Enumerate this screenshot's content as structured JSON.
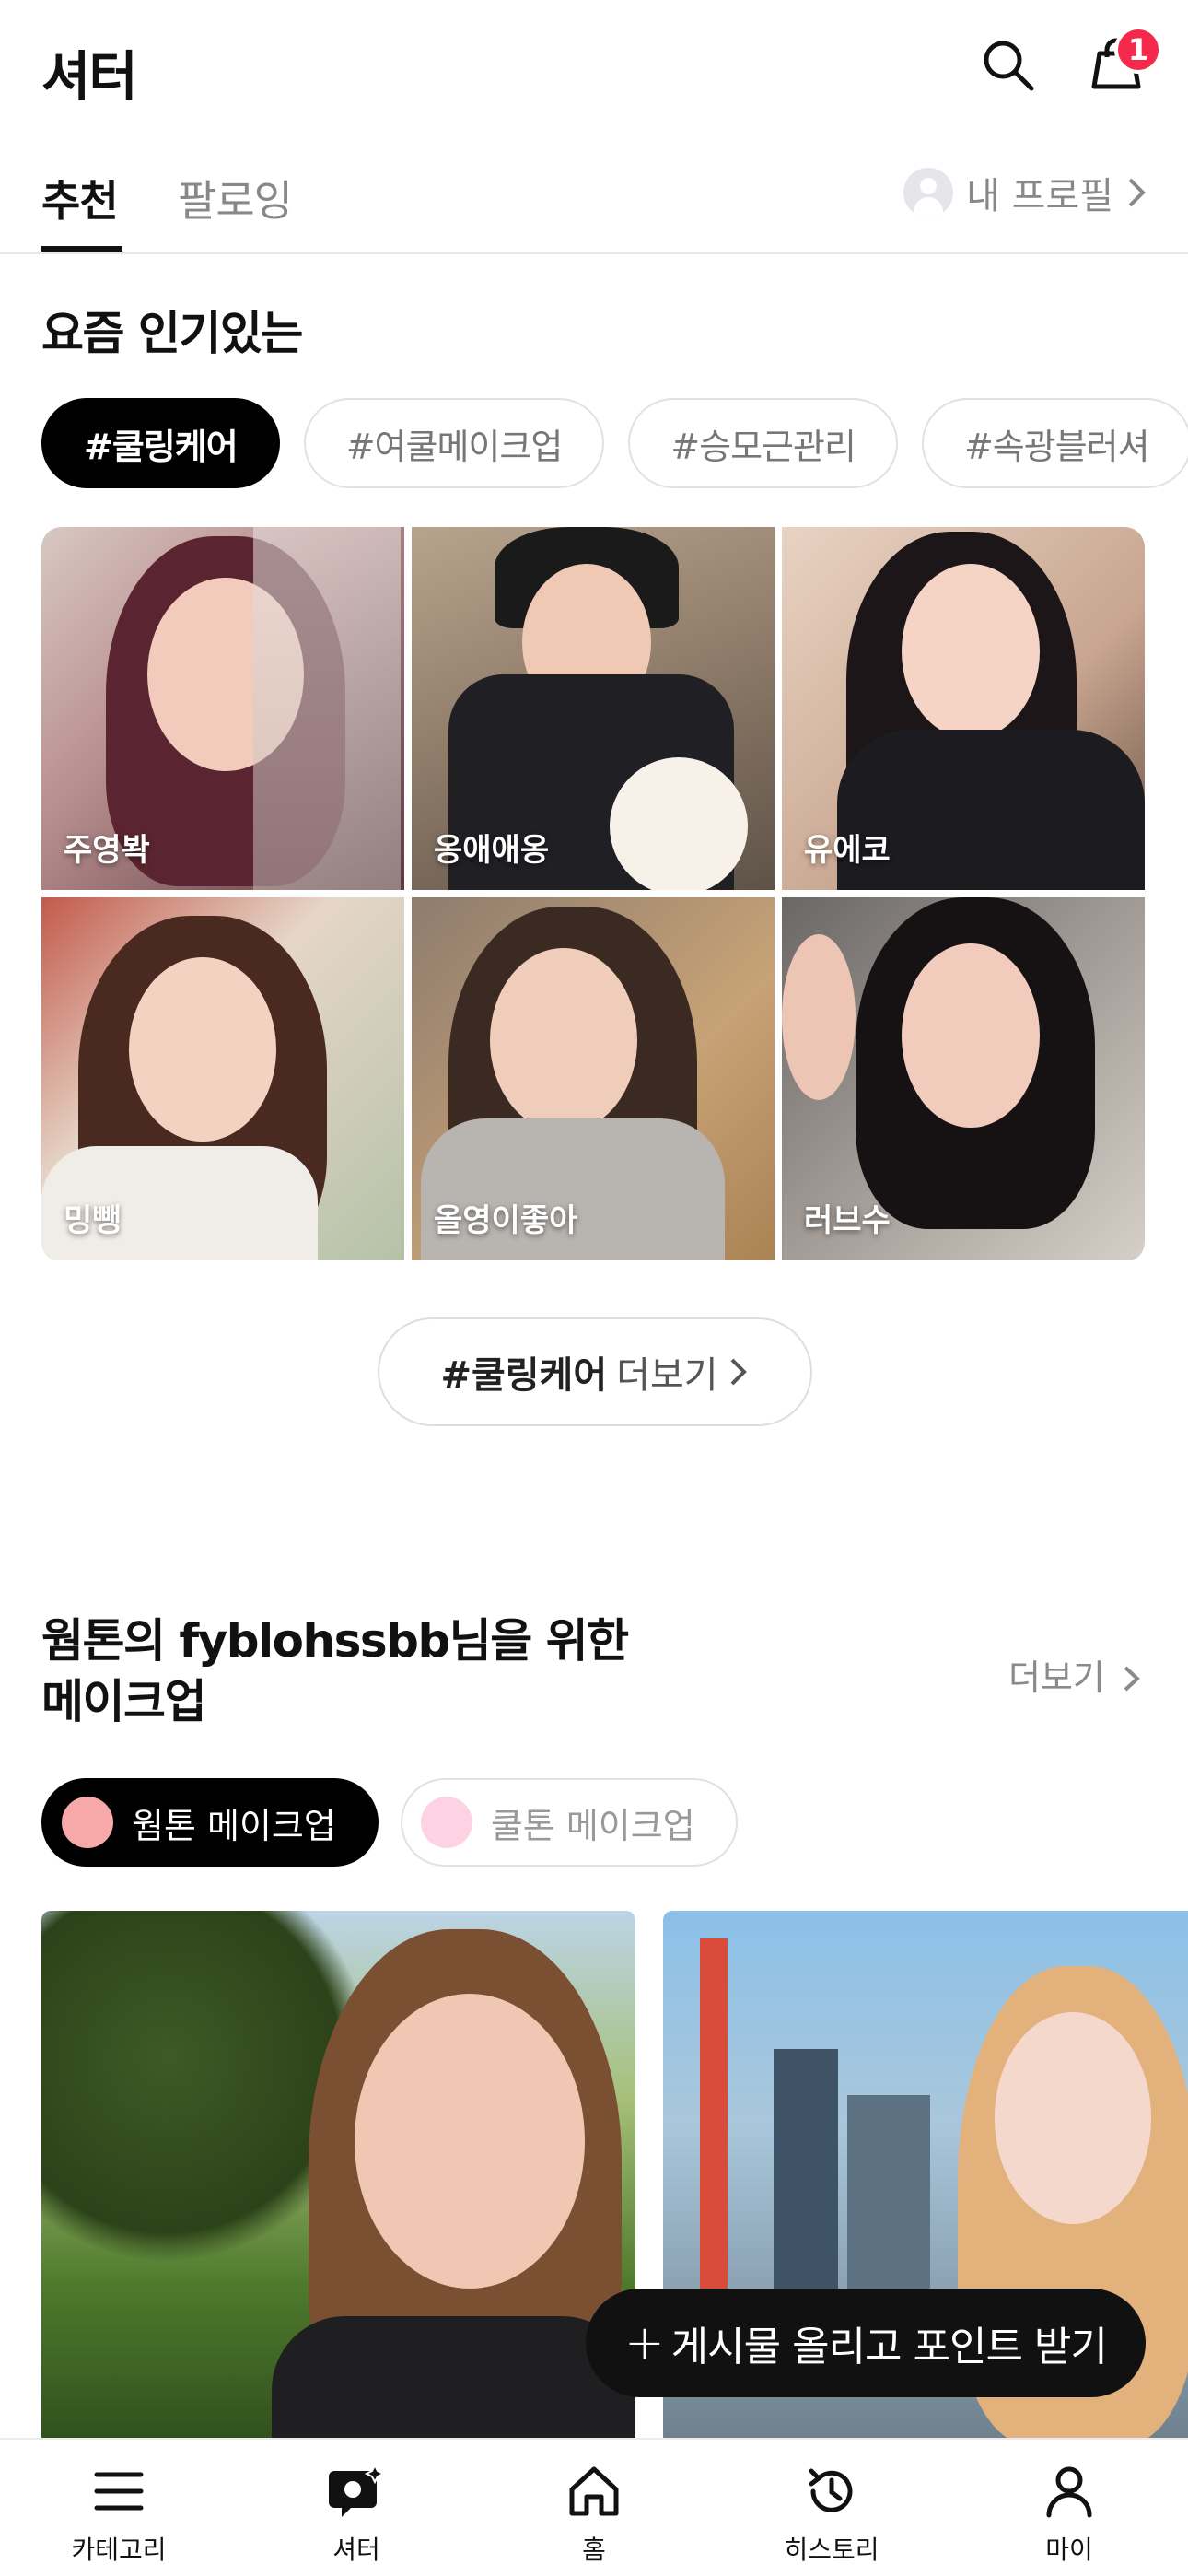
{
  "header": {
    "title": "셔터",
    "cart_count": "1"
  },
  "tabs": {
    "recommend": "추천",
    "following": "팔로잉",
    "my_profile": "내 프로필"
  },
  "popular": {
    "title": "요즘 인기있는",
    "chips": [
      "#쿨링케어",
      "#여쿨메이크업",
      "#승모근관리",
      "#속광블러셔"
    ],
    "users": [
      "주영봑",
      "옹애애옹",
      "유에코",
      "밍뺑",
      "올영이좋아",
      "러브수"
    ],
    "more_tag": "#쿨링케어",
    "more_label": "더보기"
  },
  "recommend_section": {
    "title_line1": "웜톤의 fyblohssbb님을 위한",
    "title_line2": "메이크업",
    "more": "더보기",
    "tones": [
      {
        "label": "웜톤 메이크업",
        "color": "#f7a8a8"
      },
      {
        "label": "쿨톤 메이크업",
        "color": "#fdd3e3"
      }
    ]
  },
  "fab": {
    "label": "게시물 올리고 포인트 받기"
  },
  "nav": [
    {
      "label": "카테고리",
      "icon": "menu-icon"
    },
    {
      "label": "셔터",
      "icon": "shutter-icon"
    },
    {
      "label": "홈",
      "icon": "home-icon"
    },
    {
      "label": "히스토리",
      "icon": "history-icon"
    },
    {
      "label": "마이",
      "icon": "person-icon"
    }
  ]
}
